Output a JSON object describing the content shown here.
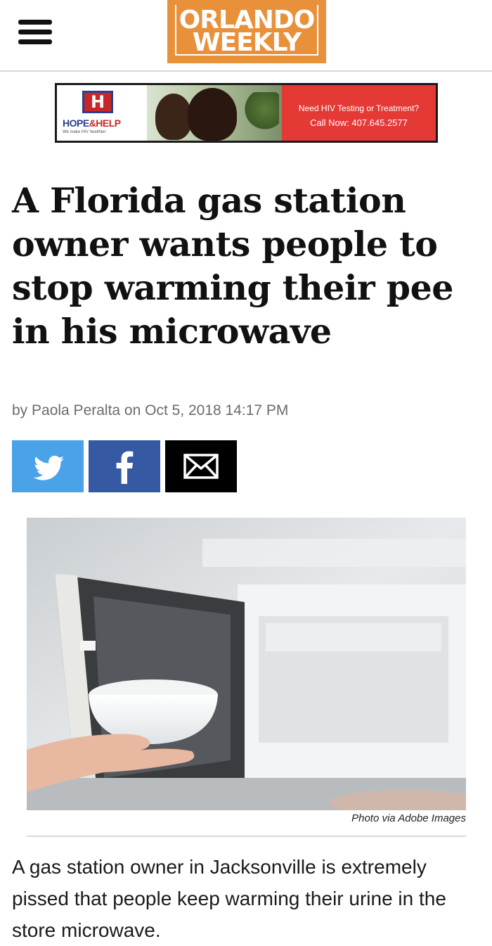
{
  "header": {
    "logo_line1": "ORLANDO",
    "logo_line2": "WEEKLY",
    "menu_icon": "hamburger-menu-icon",
    "brand_color": "#e8903a"
  },
  "ad": {
    "brand_letter": "H",
    "brand_name_part1": "HOPE",
    "brand_name_part2": "&HELP",
    "tagline": "We make HIV healthier",
    "line1": "Need HIV Testing or Treatment?",
    "line2": "Call Now: 407.645.2577"
  },
  "article": {
    "headline": "A Florida gas station owner wants people to stop warming their pee in his microwave",
    "byline": "by Paola Peralta on Oct 5, 2018 14:17 PM",
    "share": {
      "twitter_icon": "twitter-icon",
      "facebook_icon": "facebook-icon",
      "email_icon": "email-icon"
    },
    "photo_caption": "Photo via Adobe Images",
    "body": "A gas station owner in Jacksonville is extremely pissed that people keep warming their urine in the store microwave."
  },
  "colors": {
    "twitter": "#4aa3e8",
    "facebook": "#355aa3",
    "email": "#000000",
    "ad_red": "#e53935"
  }
}
